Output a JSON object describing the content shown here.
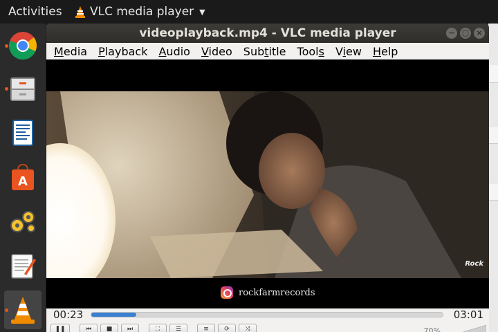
{
  "topbar": {
    "activities": "Activities",
    "app_name": "VLC media player"
  },
  "dock": {
    "items": [
      {
        "name": "Chrome",
        "icon": "chrome-icon"
      },
      {
        "name": "Files",
        "icon": "files-icon"
      },
      {
        "name": "Writer",
        "icon": "writer-icon"
      },
      {
        "name": "Software",
        "icon": "software-icon"
      },
      {
        "name": "Settings",
        "icon": "settings-icon"
      },
      {
        "name": "Text Editor",
        "icon": "text-editor-icon"
      },
      {
        "name": "VLC",
        "icon": "vlc-icon"
      }
    ]
  },
  "window": {
    "title": "videoplayback.mp4 - VLC media player",
    "buttons": {
      "minimize": "−",
      "maximize": "▢",
      "close": "×"
    }
  },
  "menubar": {
    "items": [
      {
        "label": "Media",
        "mnemonic": "M"
      },
      {
        "label": "Playback",
        "mnemonic": "P"
      },
      {
        "label": "Audio",
        "mnemonic": "A"
      },
      {
        "label": "Video",
        "mnemonic": "V"
      },
      {
        "label": "Subtitle",
        "mnemonic": "t"
      },
      {
        "label": "Tools",
        "mnemonic": "s"
      },
      {
        "label": "View",
        "mnemonic": "i"
      },
      {
        "label": "Help",
        "mnemonic": "H"
      }
    ]
  },
  "video": {
    "overlay_handle": "rockfarmrecords",
    "watermark": "Rock"
  },
  "playback": {
    "elapsed": "00:23",
    "total": "03:01",
    "progress": 0.127,
    "volume": "70%"
  },
  "colors": {
    "accent": "#3b7fd1",
    "ubuntu_orange": "#e95420"
  }
}
